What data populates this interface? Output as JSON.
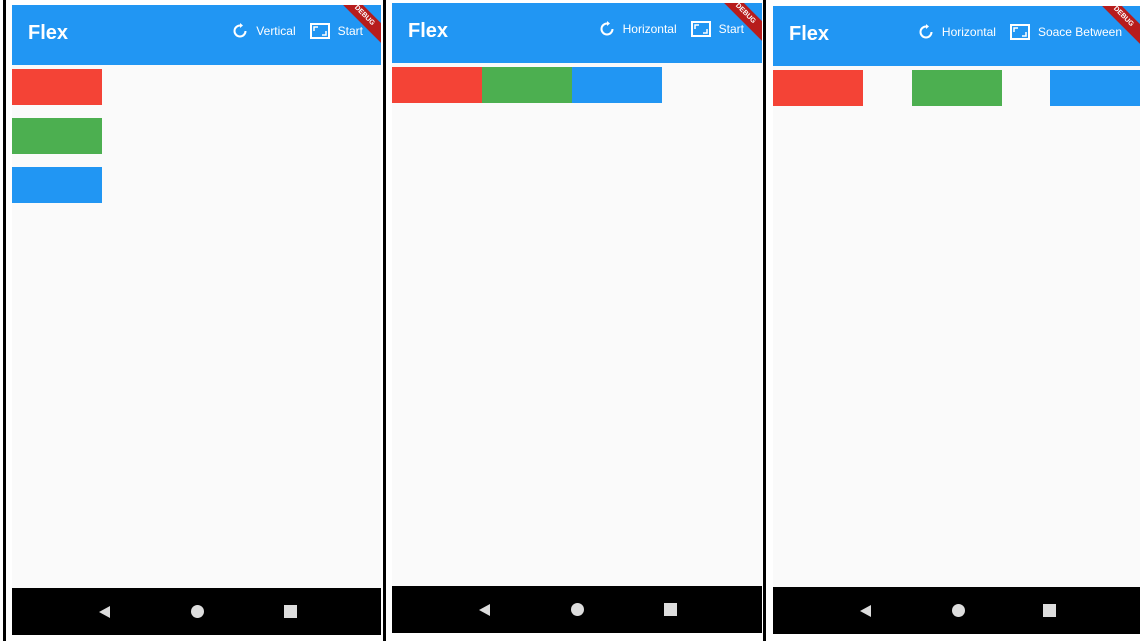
{
  "colors": {
    "appbar": "#2196f3",
    "red": "#f44336",
    "green": "#4caf50",
    "blue": "#2196f3",
    "ribbon": "#b71c1c"
  },
  "screens": [
    {
      "title": "Flex",
      "direction_label": "Vertical",
      "alignment_label": "Start",
      "debug_label": "DEBUG",
      "rotate_icon": "rotate-icon",
      "aspect_icon": "aspect-ratio-icon",
      "nav": [
        "back-icon",
        "home-icon",
        "recents-icon"
      ]
    },
    {
      "title": "Flex",
      "direction_label": "Horizontal",
      "alignment_label": "Start",
      "debug_label": "DEBUG",
      "rotate_icon": "rotate-icon",
      "aspect_icon": "aspect-ratio-icon",
      "nav": [
        "back-icon",
        "home-icon",
        "recents-icon"
      ]
    },
    {
      "title": "Flex",
      "direction_label": "Horizontal",
      "alignment_label": "Soace Between",
      "debug_label": "DEBUG",
      "rotate_icon": "rotate-icon",
      "aspect_icon": "aspect-ratio-icon",
      "nav": [
        "back-icon",
        "home-icon",
        "recents-icon"
      ]
    }
  ]
}
